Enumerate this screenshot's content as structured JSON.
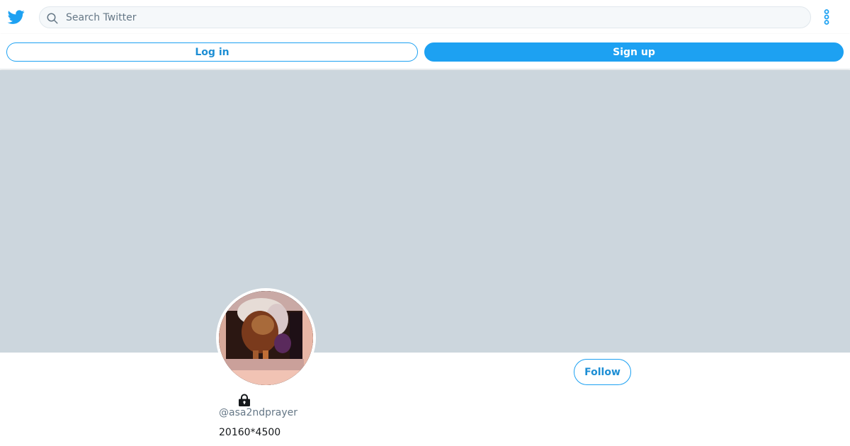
{
  "header": {
    "logo_icon": "twitter-bird-icon",
    "search": {
      "placeholder": "Search Twitter",
      "value": ""
    },
    "more_icon": "more-vertical-icon"
  },
  "auth": {
    "login_label": "Log in",
    "signup_label": "Sign up"
  },
  "profile": {
    "follow_label": "Follow",
    "lock_icon": "lock-icon",
    "handle": "@asa2ndprayer",
    "bio": "20160*4500"
  },
  "colors": {
    "brand": "#1da1f2",
    "banner": "#ccd6dd",
    "secondary_text": "#657786"
  }
}
